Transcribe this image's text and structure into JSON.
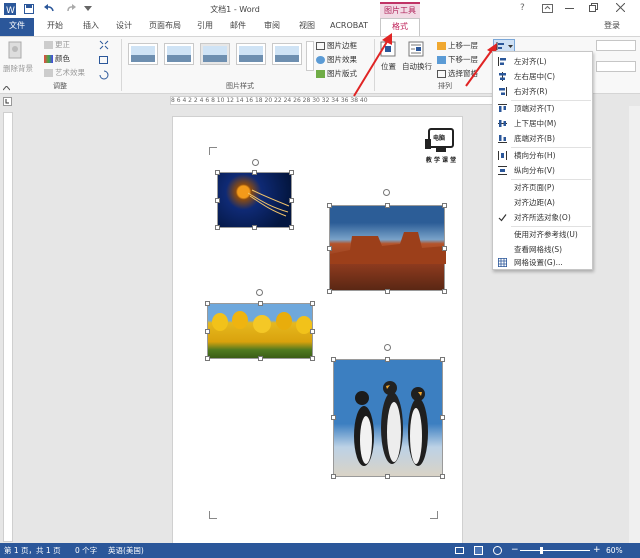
{
  "title": "文档1 - Word",
  "title_help": "?",
  "ctx_group": "图片工具",
  "tabs": [
    "文件",
    "开始",
    "插入",
    "设计",
    "页面布局",
    "引用",
    "邮件",
    "审阅",
    "视图",
    "ACROBAT",
    "格式"
  ],
  "login": "登录",
  "ribbon": {
    "remove_bg": "删除背景",
    "correct": "更正",
    "color": "颜色",
    "artistic": "艺术效果",
    "adjust_label": "调整",
    "pic_styles_label": "图片样式",
    "border": "图片边框",
    "effects": "图片效果",
    "layout": "图片版式",
    "position": "位置",
    "wrap": "自动换行",
    "bring_forward": "上移一层",
    "send_backward": "下移一层",
    "selection_pane": "选择窗格",
    "arrange_label": "排列"
  },
  "ruler_numbers": "8  6  4  2     2  4  6  8  10  12  14  16  18  20  22  24  26  28  30  32  34  36  38  40",
  "logo_text": "教 学 课 堂",
  "logo_badge": "电脑",
  "menu": [
    {
      "label": "左对齐(L)",
      "icon": "align-left-icon"
    },
    {
      "label": "左右居中(C)",
      "icon": "align-center-icon"
    },
    {
      "label": "右对齐(R)",
      "icon": "align-right-icon"
    },
    {
      "label": "顶端对齐(T)",
      "icon": "align-top-icon"
    },
    {
      "label": "上下居中(M)",
      "icon": "align-middle-icon"
    },
    {
      "label": "底端对齐(B)",
      "icon": "align-bottom-icon"
    },
    {
      "label": "横向分布(H)",
      "icon": "distribute-horizontal-icon"
    },
    {
      "label": "纵向分布(V)",
      "icon": "distribute-vertical-icon"
    },
    {
      "label": "对齐页面(P)",
      "icon": ""
    },
    {
      "label": "对齐边距(A)",
      "icon": ""
    },
    {
      "label": "对齐所选对象(O)",
      "icon": "check-icon"
    },
    {
      "label": "使用对齐参考线(U)",
      "icon": ""
    },
    {
      "label": "查看网格线(S)",
      "icon": ""
    },
    {
      "label": "网格设置(G)...",
      "icon": "grid-icon"
    }
  ],
  "status": {
    "page": "第 1 页，共 1 页",
    "words": "0 个字",
    "lang": "英语(美国)",
    "zoom": "60%"
  },
  "colors": {
    "word_blue": "#2b579a",
    "picture_tools": "#c03466"
  }
}
